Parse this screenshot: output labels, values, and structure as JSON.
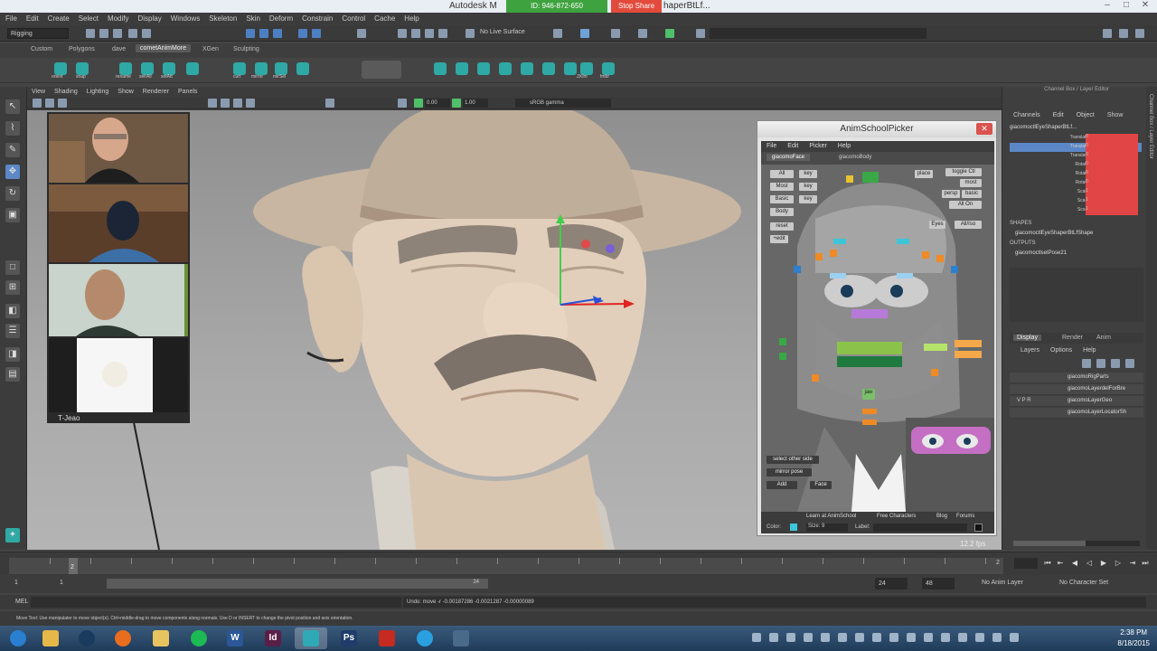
{
  "titlebar": {
    "title": "Autodesk M",
    "share_id": "ID: 946-872-650",
    "stop_share": "Stop Share",
    "title_suffix": "haperBtLf..."
  },
  "menubar": [
    "File",
    "Edit",
    "Create",
    "Select",
    "Modify",
    "Display",
    "Windows",
    "Skeleton",
    "Skin",
    "Deform",
    "Constrain",
    "Control",
    "Cache",
    "Help"
  ],
  "statusline": {
    "mode": "Rigging",
    "no_live_surface": "No Live Surface"
  },
  "shelf": {
    "tabs": [
      "Custom",
      "Polygons",
      "dave",
      "cometAnimMore",
      "XGen",
      "Sculpting"
    ],
    "active_tab": "cometAnimMore",
    "labels": [
      "orient",
      "snap",
      "rename",
      "selrAll",
      "setAtt",
      "curt",
      "mirror",
      "mirSel",
      "ZKlm",
      "fmbr"
    ]
  },
  "panel": {
    "menu": [
      "View",
      "Shading",
      "Lighting",
      "Show",
      "Renderer",
      "Panels"
    ],
    "near": "0.00",
    "far": "1.00",
    "color_mgmt": "sRGB gamma"
  },
  "webcams": {
    "caption": "T-Jeao"
  },
  "picker": {
    "title": "AnimSchoolPicker",
    "menu": [
      "File",
      "Edit",
      "Picker",
      "Help"
    ],
    "tabs": [
      "giacomoFace",
      "giacomoBody"
    ],
    "active_tab": "giacomoFace",
    "buttons": {
      "all": "All",
      "key1": "key",
      "most": "Most",
      "key2": "key",
      "basic": "Basic",
      "key3": "key",
      "body": "Body",
      "reset": "reset",
      "edit": "+edit",
      "place": "place",
      "toggle": "toggle Ctl",
      "most2": "most",
      "persp": "persp",
      "basic2": "basic",
      "all_on": "All On",
      "eyes": "Eyes",
      "all_off": "All/Iso",
      "jaw": "jaw",
      "select_other_side": "select other side",
      "mirror_pose": "mirror pose",
      "add": "Add",
      "face": "Face"
    },
    "footer_links": [
      "Learn at AnimSchool",
      "Free Characters",
      "Blog",
      "Forums"
    ],
    "color_label": "Color:",
    "size_label": "Size: 9",
    "label_label": "Label:"
  },
  "fps": "12.2 fps",
  "channelbox": {
    "header": "Channel Box / Layer Editor",
    "menu": [
      "Channels",
      "Edit",
      "Object",
      "Show"
    ],
    "object": "giacomoctlEyeShaperBtLf...",
    "channels": [
      {
        "label": "Translate X",
        "value": "0"
      },
      {
        "label": "Translate Y",
        "value": "0"
      },
      {
        "label": "Translate Z",
        "value": "0"
      },
      {
        "label": "Rotate X",
        "value": "0"
      },
      {
        "label": "Rotate Y",
        "value": "0"
      },
      {
        "label": "Rotate Z",
        "value": "0"
      },
      {
        "label": "Scale X",
        "value": "1"
      },
      {
        "label": "Scale Y",
        "value": "1"
      },
      {
        "label": "Scale Z",
        "value": "1"
      }
    ],
    "selected_channel": "Translate Y",
    "shapes_title": "SHAPES",
    "shape": "giacomoctlEyeShaperBtLfShape",
    "outputs_title": "OUTPUTS",
    "output": "giacomoctlsetPose21",
    "layer_tabs": [
      "Display",
      "Render",
      "Anim"
    ],
    "layer_menu": [
      "Layers",
      "Options",
      "Help"
    ],
    "layers": [
      {
        "vis": "",
        "name": "giacomoRigParts"
      },
      {
        "vis": "",
        "name": "giacomoLayerdelForBre"
      },
      {
        "vis": "V P R",
        "name": "giacomoLayerGeo"
      },
      {
        "vis": "",
        "name": "giacomoLayerLocatorSh"
      }
    ]
  },
  "timeline": {
    "current_frame": "2",
    "frame_field": "2",
    "range_start": "1",
    "range_start2": "1",
    "range_inner_end": "24",
    "range_end": "24",
    "range_end2": "48",
    "no_anim_layer": "No Anim Layer",
    "no_char_set": "No Character Set"
  },
  "cmdline": {
    "mel": "MEL",
    "result": "Undo: move -r -0.00187286 -0.0021287 -0.00000089"
  },
  "helpline": "Move Tool: Use manipulator to move object(s). Ctrl+middle-drag to move components along normals. Use D or INSERT to change the pivot position and axis orientation.",
  "taskbar": {
    "apps": [
      {
        "name": "windows-start",
        "glyph": "",
        "color": "#2a7fd0"
      },
      {
        "name": "file-explorer",
        "glyph": "",
        "color": "#e6b84a"
      },
      {
        "name": "steam",
        "glyph": "",
        "color": "#1b3b5e"
      },
      {
        "name": "firefox",
        "glyph": "",
        "color": "#e86d1f"
      },
      {
        "name": "folder",
        "glyph": "",
        "color": "#e8c460"
      },
      {
        "name": "spotify",
        "glyph": "",
        "color": "#1db954"
      },
      {
        "name": "word",
        "glyph": "W",
        "color": "#2b5797"
      },
      {
        "name": "indesign",
        "glyph": "Id",
        "color": "#5a1f46"
      },
      {
        "name": "maya",
        "glyph": "",
        "color": "#2fa9b5"
      },
      {
        "name": "photoshop",
        "glyph": "Ps",
        "color": "#1f3c6a"
      },
      {
        "name": "acrobat",
        "glyph": "",
        "color": "#c52b20"
      },
      {
        "name": "skype",
        "glyph": "",
        "color": "#2aa0e0"
      },
      {
        "name": "pen-tool",
        "glyph": "",
        "color": "#4a6a8a"
      }
    ],
    "time": "2:38 PM",
    "date": "8/18/2015"
  },
  "colors": {
    "accent_red": "#e24545",
    "selection_blue": "#5b87c6",
    "maya_teal": "#2fa9a5",
    "picker_orange": "#f08a24"
  }
}
